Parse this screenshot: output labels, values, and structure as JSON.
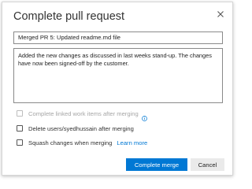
{
  "dialog": {
    "title": "Complete pull request",
    "close_icon": "close-icon"
  },
  "form": {
    "title_value": "Merged PR 5: Updated readme.md file",
    "description_value": "Added the new changes as discussed in last weeks stand-up. The changes have now been signed-off by the customer."
  },
  "options": {
    "complete_work_items": {
      "label": "Complete linked work items after merging",
      "checked": false,
      "disabled": true,
      "icon": "info-icon"
    },
    "delete_branch": {
      "label": "Delete users/syedhussain after merging",
      "checked": false
    },
    "squash": {
      "label": "Squash changes when merging",
      "checked": false,
      "link": "Learn more"
    }
  },
  "buttons": {
    "complete": "Complete merge",
    "cancel": "Cancel"
  },
  "colors": {
    "accent": "#0078d4",
    "secondary_button": "#eaeaea",
    "disabled_text": "#a6a6a6"
  }
}
